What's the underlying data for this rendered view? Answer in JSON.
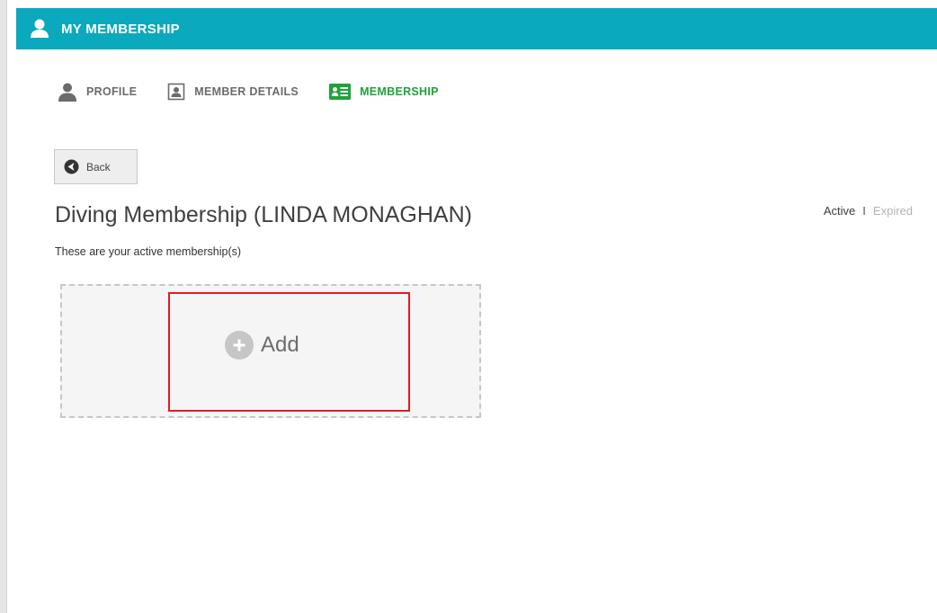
{
  "header": {
    "title": "MY MEMBERSHIP",
    "icon": "user-icon",
    "color": "#0aa9bd"
  },
  "tabs": [
    {
      "label": "PROFILE",
      "icon": "person-icon",
      "active": false
    },
    {
      "label": "MEMBER DETAILS",
      "icon": "id-photo-icon",
      "active": false
    },
    {
      "label": "MEMBERSHIP",
      "icon": "membership-card-icon",
      "active": true
    }
  ],
  "back": {
    "label": "Back",
    "icon": "back-arrow-icon"
  },
  "page": {
    "title": "Diving Membership (LINDA MONAGHAN)",
    "subtitle": "These are your active membership(s)"
  },
  "filter": {
    "active": "Active",
    "separator": "I",
    "expired": "Expired"
  },
  "add": {
    "label": "Add",
    "icon": "plus-circle-icon",
    "highlight_color": "#e21b25"
  },
  "colors": {
    "accent": "#0aa9bd",
    "active_tab": "#1ea33b"
  }
}
